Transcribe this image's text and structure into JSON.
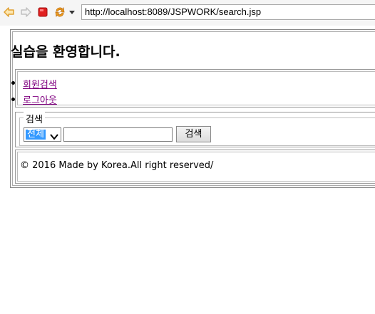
{
  "browser": {
    "url": "http://localhost:8089/JSPWORK/search.jsp",
    "back_icon": "back-arrow-icon",
    "forward_icon": "forward-arrow-icon",
    "stop_icon": "stop-icon",
    "refresh_icon": "refresh-icon",
    "menu_icon": "dropdown-triangle-icon"
  },
  "page": {
    "title": "실습을 환영합니다.",
    "menu": [
      {
        "label": "회원검색"
      },
      {
        "label": "로그아웃"
      }
    ],
    "search": {
      "legend": "검색",
      "select_value": "전체",
      "input_value": "",
      "button_label": "검색"
    },
    "footer": "© 2016 Made by Korea.All right reserved/"
  },
  "colors": {
    "link_visited": "#800080",
    "selection": "#3399ff",
    "stop_red": "#e02020",
    "nav_orange": "#e8a020"
  }
}
